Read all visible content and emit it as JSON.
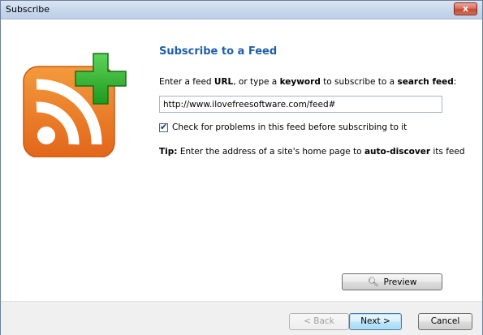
{
  "window": {
    "title": "Subscribe",
    "close_glyph": "x"
  },
  "icons": {
    "logo": "rss-feed-add-icon",
    "close": "close-icon",
    "preview": "magnifier-icon",
    "checkmark": "checkmark-icon"
  },
  "main": {
    "heading": "Subscribe to a Feed",
    "instruction": {
      "t1": "Enter a feed ",
      "b1": "URL",
      "t2": ", or type a ",
      "b2": "keyword",
      "t3": " to subscribe to a ",
      "b3": "search feed",
      "t4": ":"
    },
    "url_value": "http://www.ilovefreesoftware.com/feed#",
    "checkbox": {
      "checked": true,
      "label": "Check for problems in this feed before subscribing to it"
    },
    "tip": {
      "b1": "Tip:",
      "t1": " Enter the address of a site's home page to ",
      "b2": "auto-discover",
      "t2": " its feed"
    },
    "preview_label": "Preview"
  },
  "footer": {
    "back_label": "< Back",
    "next_label": "Next >",
    "cancel_label": "Cancel"
  },
  "colors": {
    "heading": "#1e5fa8",
    "rss_orange": "#ee7d22",
    "plus_green": "#2db22a"
  }
}
